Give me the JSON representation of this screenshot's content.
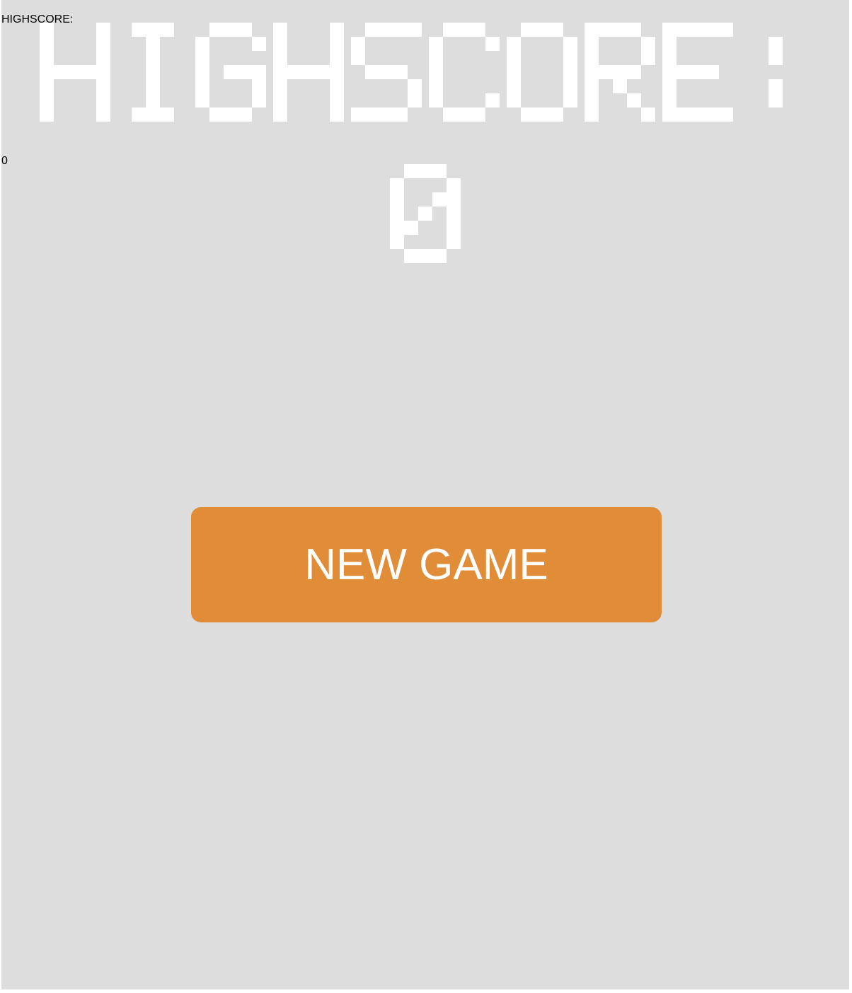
{
  "game": {
    "highscore_label": "HIGHSCORE:",
    "highscore_value": "0",
    "new_game_label": "NEW GAME"
  },
  "colors": {
    "background": "#dddddd",
    "text": "#ffffff",
    "button": "#e18c37",
    "button_text": "#ffffff"
  }
}
